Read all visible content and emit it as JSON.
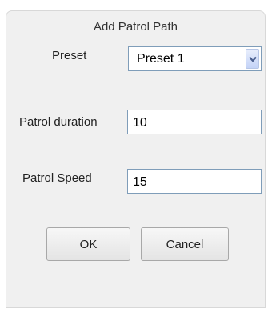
{
  "dialog": {
    "title": "Add Patrol Path"
  },
  "fields": {
    "preset": {
      "label": "Preset",
      "selected": "Preset 1"
    },
    "duration": {
      "label": "Patrol duration",
      "value": "10"
    },
    "speed": {
      "label": "Patrol Speed",
      "value": "15"
    }
  },
  "buttons": {
    "ok": "OK",
    "cancel": "Cancel"
  },
  "icons": {
    "dropdown": "chevron-down-icon"
  },
  "colors": {
    "dialog_bg": "#f0f0f0",
    "input_border": "#7f9db9",
    "arrow_accent": "#4a5f8f"
  }
}
